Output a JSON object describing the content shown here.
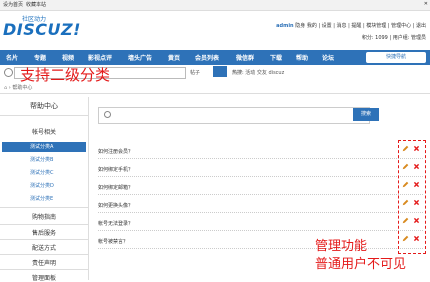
{
  "topbar": {
    "set_home": "设为首页",
    "bookmark": "收藏本站",
    "close": "✕"
  },
  "logo": {
    "sub": "社区动力",
    "main": "DISCUZ!"
  },
  "user": {
    "name": "admin",
    "status": "隐身",
    "line1": "我的 | 设置 | 消息 | 提醒 | 模块管理 | 管理中心 | 退出",
    "line2": "积分: 1099 | 用户组: 管理员"
  },
  "nav": {
    "items": [
      "名片",
      "专题",
      "视频",
      "影视点评",
      "墙头广告",
      "黄页",
      "会员列表",
      "微信群",
      "下载",
      "帮助",
      "论坛"
    ],
    "fast": "快捷导航"
  },
  "search": {
    "type": "帖子",
    "hot_label": "热搜:",
    "hot": [
      "活动",
      "交友",
      "discuz"
    ]
  },
  "overlay": {
    "top": "支持二级分类",
    "bottom1": "管理功能",
    "bottom2": "普通用户不可见"
  },
  "breadcrumb": "帮助中心",
  "sidebar": {
    "title": "帮助中心",
    "group1": "帐号相关",
    "items": [
      "测试分类A",
      "测试分类B",
      "测试分类C",
      "测试分类D",
      "测试分类E"
    ],
    "groups": [
      "购物指南",
      "售后服务",
      "配送方式",
      "责任声明",
      "管理面板"
    ]
  },
  "main": {
    "search_button": "搜索",
    "questions": [
      "如何注册会员？",
      "如何绑定手机？",
      "如何绑定邮箱？",
      "如何更换头像？",
      "帐号无法登录？",
      "帐号被禁言？"
    ]
  }
}
